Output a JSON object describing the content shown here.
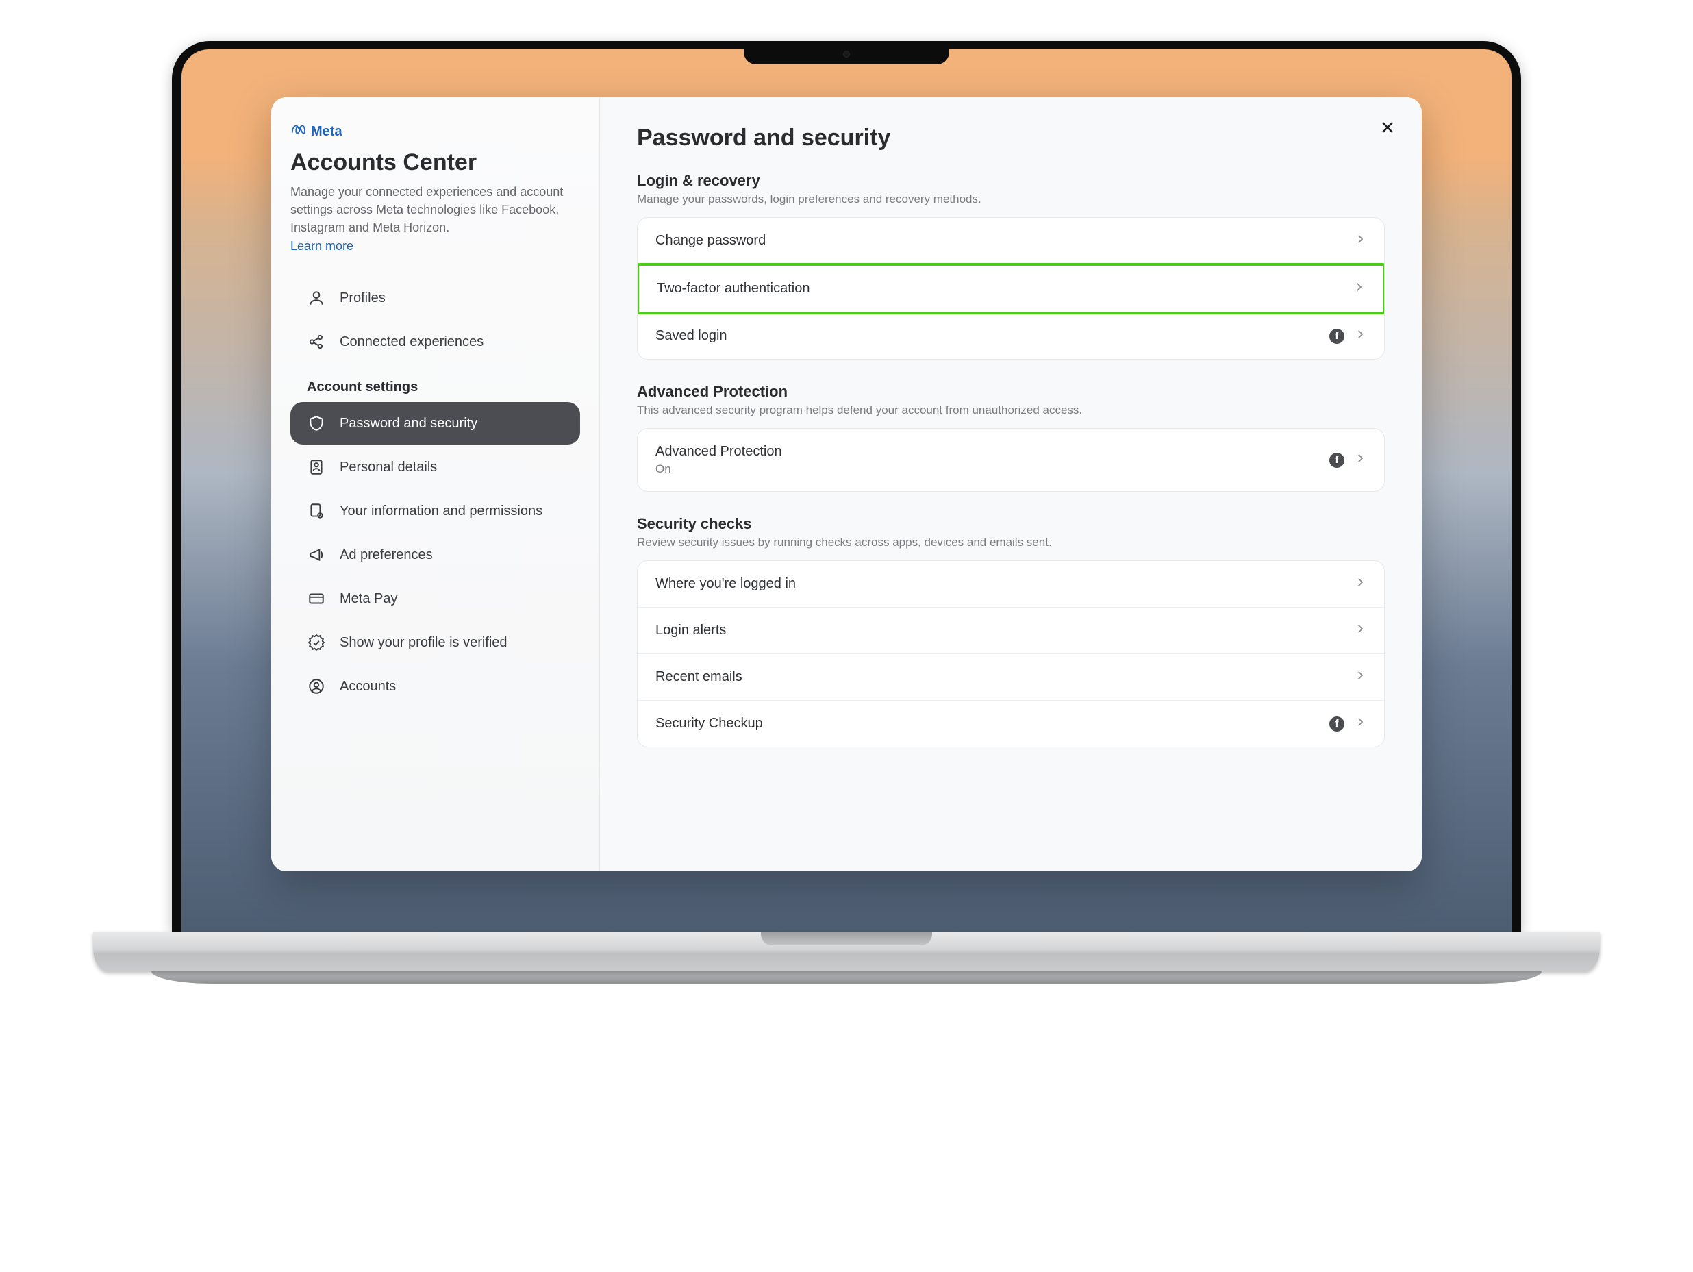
{
  "brand": {
    "name": "Meta"
  },
  "sidebar": {
    "title": "Accounts Center",
    "description": "Manage your connected experiences and account settings across Meta technologies like Facebook, Instagram and Meta Horizon.",
    "learn_more": "Learn more",
    "top_items": [
      {
        "label": "Profiles"
      },
      {
        "label": "Connected experiences"
      }
    ],
    "section_heading": "Account settings",
    "settings_items": [
      {
        "label": "Password and security",
        "active": true
      },
      {
        "label": "Personal details"
      },
      {
        "label": "Your information and permissions"
      },
      {
        "label": "Ad preferences"
      },
      {
        "label": "Meta Pay"
      },
      {
        "label": "Show your profile is verified"
      },
      {
        "label": "Accounts"
      }
    ]
  },
  "main": {
    "title": "Password and security",
    "sections": [
      {
        "title": "Login & recovery",
        "subtitle": "Manage your passwords, login preferences and recovery methods.",
        "rows": [
          {
            "label": "Change password"
          },
          {
            "label": "Two-factor authentication",
            "highlight": true
          },
          {
            "label": "Saved login",
            "fb": true
          }
        ]
      },
      {
        "title": "Advanced Protection",
        "subtitle": "This advanced security program helps defend your account from unauthorized access.",
        "rows": [
          {
            "label": "Advanced Protection",
            "sub": "On",
            "fb": true
          }
        ]
      },
      {
        "title": "Security checks",
        "subtitle": "Review security issues by running checks across apps, devices and emails sent.",
        "rows": [
          {
            "label": "Where you're logged in"
          },
          {
            "label": "Login alerts"
          },
          {
            "label": "Recent emails"
          },
          {
            "label": "Security Checkup",
            "fb": true
          }
        ]
      }
    ]
  }
}
